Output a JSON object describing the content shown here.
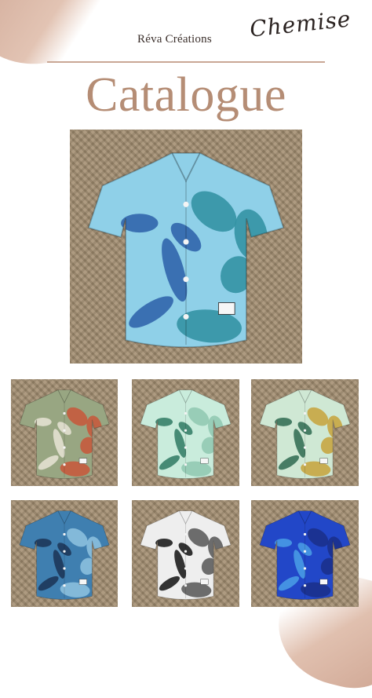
{
  "header": {
    "brand": "Réva Créations",
    "script_title": "Chemise",
    "title": "Catalogue"
  },
  "colors": {
    "accent": "#b58d75",
    "rule": "#c9a795",
    "background_mat": "#a48f72"
  },
  "products": [
    {
      "name": "blue-monstera-shirt",
      "base": "#8fd0e8",
      "print": "#2b5fa8",
      "print2": "#2f8fa0"
    },
    {
      "name": "sage-floral-shirt",
      "base": "#98a682",
      "print": "#e8e4d6",
      "print2": "#c8563a"
    },
    {
      "name": "mint-monstera-shirt",
      "base": "#c9ecdc",
      "print": "#2f7a63",
      "print2": "#8fc8b0"
    },
    {
      "name": "green-leaf-shirt",
      "base": "#cfe8d4",
      "print": "#2e6a50",
      "print2": "#c7a23a"
    },
    {
      "name": "navy-tribal-shirt",
      "base": "#3f7fb0",
      "print": "#1b3355",
      "print2": "#8fc3e0"
    },
    {
      "name": "black-white-tribal-shirt",
      "base": "#eeeeee",
      "print": "#111111",
      "print2": "#555555"
    },
    {
      "name": "royal-blue-tribal-shirt",
      "base": "#2247c8",
      "print": "#4aa0e6",
      "print2": "#1a2f88"
    }
  ]
}
